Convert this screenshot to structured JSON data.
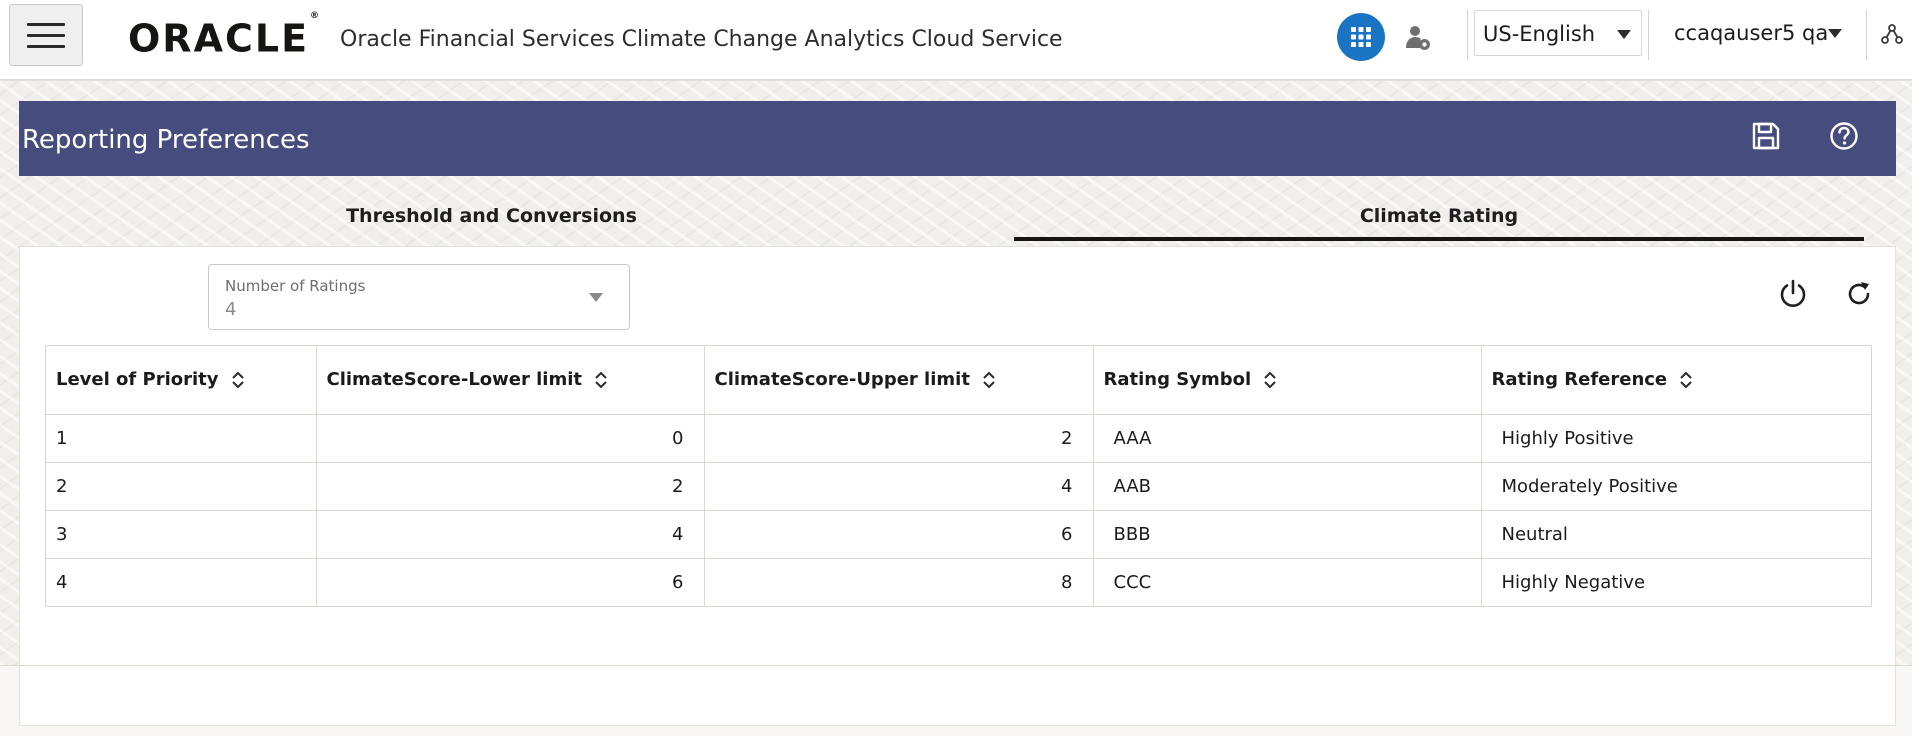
{
  "header": {
    "logo_text": "ORACLE",
    "logo_mark": "®",
    "app_title": "Oracle Financial Services Climate Change Analytics Cloud Service",
    "apps_icon": "grid-apps-icon",
    "language": "US-English",
    "user": "ccaqauser5 qa",
    "accent_color": "#1a74c4"
  },
  "page": {
    "title": "Reporting Preferences",
    "header_color": "#474c7e",
    "tabs": [
      {
        "label": "Threshold and Conversions",
        "active": false
      },
      {
        "label": "Climate Rating",
        "active": true
      }
    ]
  },
  "form": {
    "number_of_ratings_label": "Number of Ratings",
    "number_of_ratings_value": "4"
  },
  "table": {
    "columns": [
      "Level of Priority",
      "ClimateScore-Lower limit",
      "ClimateScore-Upper limit",
      "Rating Symbol",
      "Rating Reference"
    ],
    "rows": [
      {
        "priority": "1",
        "lower": "0",
        "upper": "2",
        "symbol": "AAA",
        "reference": "Highly Positive"
      },
      {
        "priority": "2",
        "lower": "2",
        "upper": "4",
        "symbol": "AAB",
        "reference": "Moderately Positive"
      },
      {
        "priority": "3",
        "lower": "4",
        "upper": "6",
        "symbol": "BBB",
        "reference": "Neutral"
      },
      {
        "priority": "4",
        "lower": "6",
        "upper": "8",
        "symbol": "CCC",
        "reference": "Highly Negative"
      }
    ]
  }
}
